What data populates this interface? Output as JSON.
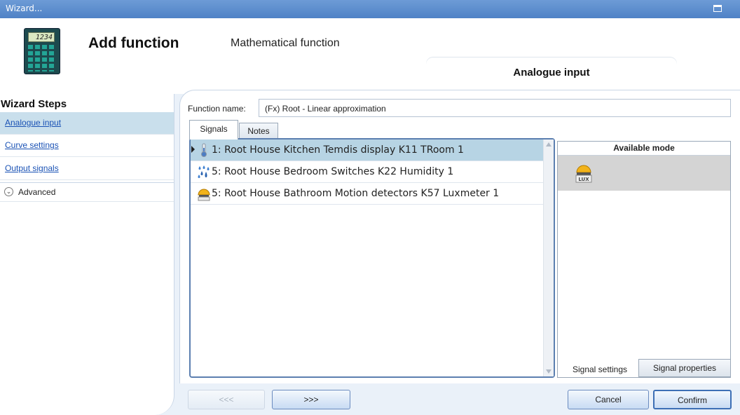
{
  "window": {
    "title": "Wizard..."
  },
  "header": {
    "calc_display": "1234",
    "title": "Add function",
    "subtitle": "Mathematical function",
    "current_step": "Analogue input"
  },
  "sidebar": {
    "heading": "Wizard Steps",
    "items": [
      {
        "label": "Analogue input",
        "active": true
      },
      {
        "label": "Curve settings",
        "active": false
      },
      {
        "label": "Output signals",
        "active": false
      }
    ],
    "advanced_label": "Advanced"
  },
  "form": {
    "function_name_label": "Function name:",
    "function_name_value": "(Fx) Root - Linear approximation"
  },
  "tabs": {
    "signals": "Signals",
    "notes": "Notes"
  },
  "signals": [
    {
      "text": "1: Root House Kitchen Temdis display K11 TRoom 1",
      "icon": "thermometer-icon",
      "selected": true
    },
    {
      "text": "5: Root House Bedroom Switches K22 Humidity 1",
      "icon": "humidity-drops-icon",
      "selected": false
    },
    {
      "text": "5: Root House Bathroom Motion detectors K57 Luxmeter 1",
      "icon": "lux-sensor-icon",
      "selected": false
    }
  ],
  "modes": {
    "header": "Available mode",
    "lux_label": "LUX",
    "tab_settings": "Signal settings",
    "tab_properties": "Signal properties"
  },
  "buttons": {
    "back": "<<<",
    "next": ">>>",
    "cancel": "Cancel",
    "confirm": "Confirm"
  },
  "colors": {
    "titlebar": "#5a8ccd",
    "selected_row": "#b7d4e4",
    "link": "#1a52b5"
  }
}
